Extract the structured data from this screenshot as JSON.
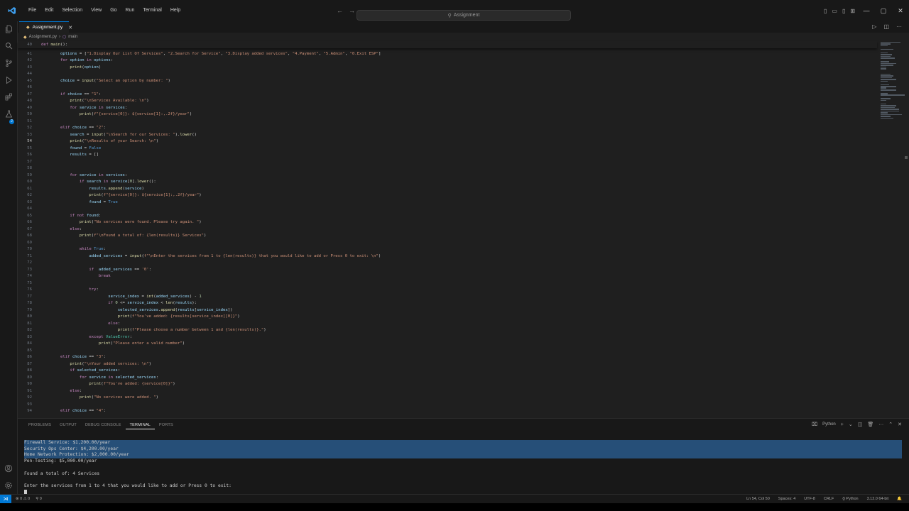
{
  "menu": [
    "File",
    "Edit",
    "Selection",
    "View",
    "Go",
    "Run",
    "Terminal",
    "Help"
  ],
  "search": {
    "text": "Assignment"
  },
  "tab": {
    "label": "Assignment.py",
    "close": "✕"
  },
  "breadcrumbs": {
    "file": "Assignment.py",
    "sep": "›",
    "symbol": "main"
  },
  "sticky": {
    "ln": "40",
    "text": "def main():"
  },
  "lines": [
    {
      "ln": "41",
      "text": "        options = [\"1.Display Our List Of Services\", \"2.Search for Service\", \"3.Display added services\", \"4.Payment\", \"5.Admin\", \"0.Exit ESP\"]"
    },
    {
      "ln": "42",
      "text": "        for option in options:"
    },
    {
      "ln": "43",
      "text": "            print(option)"
    },
    {
      "ln": "44",
      "text": ""
    },
    {
      "ln": "45",
      "text": "        choice = input(\"Select an option by number: \")"
    },
    {
      "ln": "46",
      "text": ""
    },
    {
      "ln": "47",
      "text": "        if choice == \"1\":"
    },
    {
      "ln": "48",
      "text": "            print(\"\\nServices Available: \\n\")"
    },
    {
      "ln": "49",
      "text": "            for service in services:"
    },
    {
      "ln": "50",
      "text": "                print(f\"{service[0]}: ${service[1]:,.2f}/year\")"
    },
    {
      "ln": "51",
      "text": ""
    },
    {
      "ln": "52",
      "text": "        elif choice == \"2\":"
    },
    {
      "ln": "53",
      "text": "            search = input(\"\\nSearch for our Services: \").lower()"
    },
    {
      "ln": "54",
      "text": "            print(\"\\nResults of your Search: \\n\")"
    },
    {
      "ln": "55",
      "text": "            found = False"
    },
    {
      "ln": "56",
      "text": "            results = []"
    },
    {
      "ln": "57",
      "text": ""
    },
    {
      "ln": "58",
      "text": ""
    },
    {
      "ln": "59",
      "text": "            for service in services:"
    },
    {
      "ln": "60",
      "text": "                if search in service[0].lower():"
    },
    {
      "ln": "61",
      "text": "                    results.append(service)"
    },
    {
      "ln": "62",
      "text": "                    print(f\"{service[0]}: ${service[1]:,.2f}/year\")"
    },
    {
      "ln": "63",
      "text": "                    found = True"
    },
    {
      "ln": "64",
      "text": ""
    },
    {
      "ln": "65",
      "text": "            if not found:"
    },
    {
      "ln": "66",
      "text": "                print(\"No services were found. Please try again. \")"
    },
    {
      "ln": "67",
      "text": "            else:"
    },
    {
      "ln": "68",
      "text": "                print(f\"\\nFound a total of: {len(results)} Services\")"
    },
    {
      "ln": "69",
      "text": ""
    },
    {
      "ln": "70",
      "text": "                while True:"
    },
    {
      "ln": "71",
      "text": "                    added_services = input(f\"\\nEnter the services from 1 to {len(results)} that you would like to add or Press 0 to exit: \\n\")"
    },
    {
      "ln": "72",
      "text": ""
    },
    {
      "ln": "73",
      "text": "                    if  added_services == '0':"
    },
    {
      "ln": "74",
      "text": "                        break"
    },
    {
      "ln": "75",
      "text": ""
    },
    {
      "ln": "76",
      "text": "                    try:"
    },
    {
      "ln": "77",
      "text": "                            service_index = int(added_services) - 1"
    },
    {
      "ln": "78",
      "text": "                            if 0 <= service_index < len(results):"
    },
    {
      "ln": "79",
      "text": "                                selected_services.append(results[service_index])"
    },
    {
      "ln": "80",
      "text": "                                print(f\"You've added: {results[service_index][0]}\")"
    },
    {
      "ln": "81",
      "text": "                            else:"
    },
    {
      "ln": "82",
      "text": "                                print(f\"Please choose a number between 1 and {len(results)}.\")"
    },
    {
      "ln": "83",
      "text": "                    except ValueError:"
    },
    {
      "ln": "84",
      "text": "                        print(\"Please enter a valid number\")"
    },
    {
      "ln": "85",
      "text": ""
    },
    {
      "ln": "86",
      "text": "        elif choice == \"3\":"
    },
    {
      "ln": "87",
      "text": "            print(\"\\nYour added services: \\n\")"
    },
    {
      "ln": "88",
      "text": "            if selected_services:"
    },
    {
      "ln": "89",
      "text": "                for service in selected_services:"
    },
    {
      "ln": "90",
      "text": "                    print(f\"You've added: {service[0]}\")"
    },
    {
      "ln": "91",
      "text": "            else:"
    },
    {
      "ln": "92",
      "text": "                print(\"No services were added. \")"
    },
    {
      "ln": "93",
      "text": ""
    },
    {
      "ln": "94",
      "text": "        elif choice == \"4\":"
    }
  ],
  "panel": {
    "tabs": [
      "PROBLEMS",
      "OUTPUT",
      "DEBUG CONSOLE",
      "TERMINAL",
      "PORTS"
    ],
    "active_tab": "TERMINAL",
    "shell": "Python"
  },
  "terminal": [
    {
      "text": "Firewall Service: $1,200.00/year",
      "selected": true
    },
    {
      "text": "Security Ops Center: $4,200.00/year",
      "selected": true
    },
    {
      "text": "Home Network Protection: $2,000.00/year",
      "selected": true
    },
    {
      "text": "Pen-Testing: $5,000.00/year",
      "selected": false
    },
    {
      "text": "",
      "selected": false
    },
    {
      "text": "Found a total of: 4 Services",
      "selected": false
    },
    {
      "text": "",
      "selected": false
    },
    {
      "text": "Enter the services from 1 to 4 that you would like to add or Press 0 to exit:",
      "selected": false
    }
  ],
  "status": {
    "errors": "⊗ 0 ⚠ 0",
    "ports": "⚲ 0",
    "position": "Ln 54, Col 50",
    "spaces": "Spaces: 4",
    "encoding": "UTF-8",
    "eol": "CRLF",
    "language": "{} Python",
    "interpreter": "3.12.0 64-bit"
  },
  "icons": {
    "explorer": "files-icon",
    "search": "search-icon",
    "scm": "source-control-icon",
    "run": "run-debug-icon",
    "extensions": "extensions-icon",
    "testing": "flask-icon",
    "account": "account-icon",
    "settings": "gear-icon"
  }
}
